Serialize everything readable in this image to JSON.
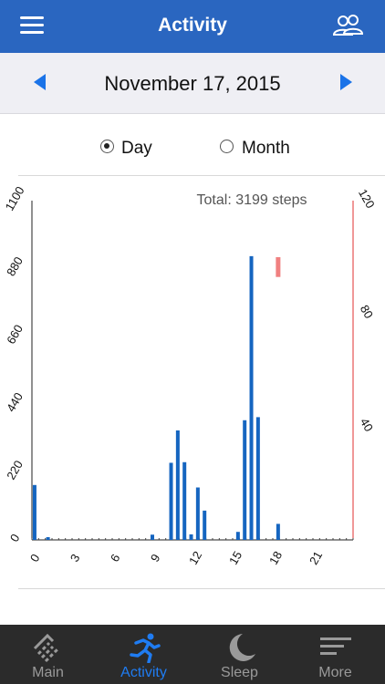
{
  "header": {
    "title": "Activity",
    "menu_icon": "hamburger-menu-icon",
    "people_icon": "people-icon"
  },
  "datebar": {
    "date": "November 17, 2015"
  },
  "modes": {
    "day": "Day",
    "month": "Month",
    "selected": "Day"
  },
  "chart_data": {
    "type": "bar",
    "title": "Total: 3199 steps",
    "y_left": {
      "ticks": [
        "0",
        "220",
        "440",
        "660",
        "880",
        "1100"
      ],
      "ylim": [
        0,
        1100
      ]
    },
    "y_right": {
      "ticks": [
        "40",
        "80",
        "120"
      ],
      "ylim": [
        0,
        120
      ]
    },
    "x_ticks": [
      "0",
      "3",
      "6",
      "9",
      "12",
      "15",
      "18",
      "21"
    ],
    "xlim": [
      0,
      24
    ],
    "series": [
      {
        "type": "steps",
        "color": "#1565c0",
        "points": [
          [
            0.2,
            178
          ],
          [
            1.2,
            9
          ],
          [
            9.0,
            17
          ],
          [
            10.4,
            250
          ],
          [
            10.9,
            355
          ],
          [
            11.4,
            252
          ],
          [
            11.9,
            18
          ],
          [
            12.4,
            170
          ],
          [
            12.9,
            95
          ],
          [
            15.4,
            26
          ],
          [
            15.9,
            388
          ],
          [
            16.4,
            920
          ],
          [
            16.9,
            398
          ],
          [
            18.4,
            52
          ]
        ]
      },
      {
        "type": "heart-rate",
        "color": "#f08080",
        "points": [
          [
            18.4,
            93,
            100
          ]
        ]
      }
    ]
  },
  "tabs": [
    {
      "label": "Main",
      "icon": "main-icon",
      "active": false
    },
    {
      "label": "Activity",
      "icon": "running-icon",
      "active": true
    },
    {
      "label": "Sleep",
      "icon": "moon-icon",
      "active": false
    },
    {
      "label": "More",
      "icon": "more-lines-icon",
      "active": false
    }
  ]
}
